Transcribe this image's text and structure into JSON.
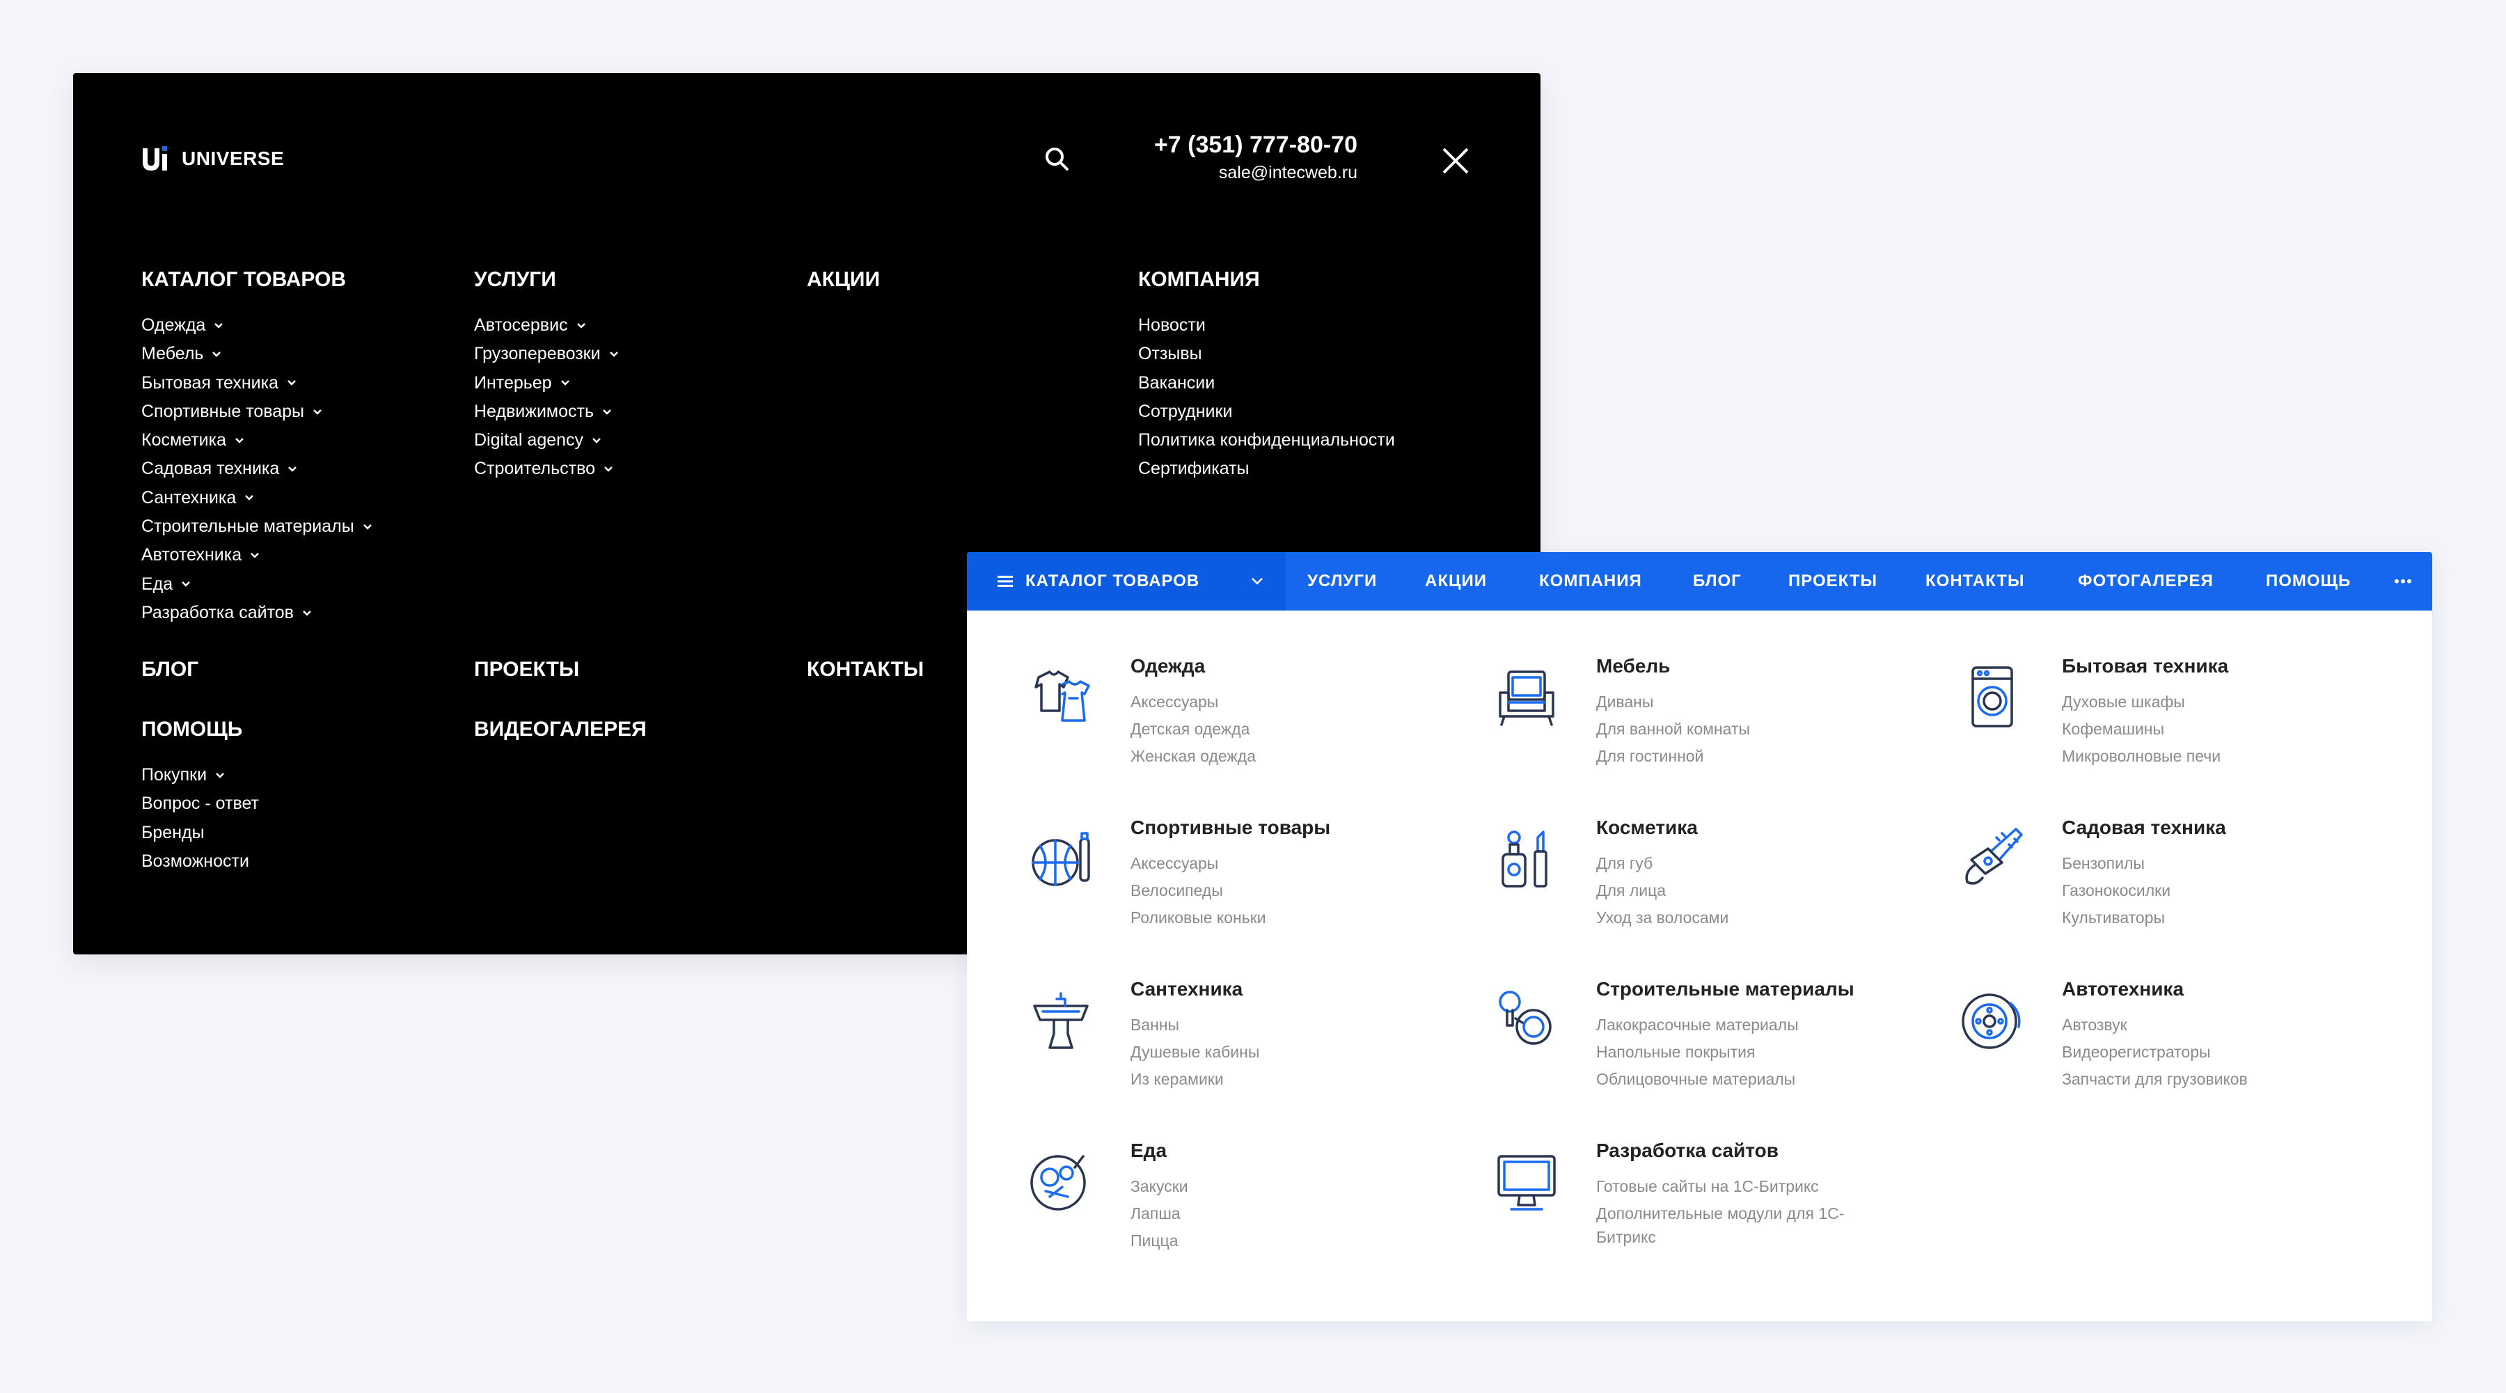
{
  "dark_menu": {
    "logo_text": "UNIVERSE",
    "phone": "+7 (351) 777-80-70",
    "email": "sale@intecweb.ru",
    "columns": [
      {
        "heading": "КАТАЛОГ ТОВАРОВ",
        "items": [
          "Одежда",
          "Мебель",
          "Бытовая техника",
          "Спортивные товары",
          "Косметика",
          "Садовая техника",
          "Сантехника",
          "Строительные материалы",
          "Автотехника",
          "Еда",
          "Разработка сайтов"
        ]
      },
      {
        "heading": "УСЛУГИ",
        "items": [
          "Автосервис",
          "Грузоперевозки",
          "Интерьер",
          "Недвижимость",
          "Digital agency",
          "Строительство"
        ]
      },
      {
        "heading": "АКЦИИ"
      },
      {
        "heading": "КОМПАНИЯ",
        "items": [
          "Новости",
          "Отзывы",
          "Вакансии",
          "Сотрудники",
          "Политика конфиденциальности",
          "Сертификаты"
        ]
      },
      {
        "heading": "БЛОГ"
      },
      {
        "heading": "ПРОЕКТЫ"
      },
      {
        "heading": "КОНТАКТЫ"
      },
      {
        "heading": "ПОМОЩЬ",
        "items": [
          "Покупки",
          "Вопрос - ответ",
          "Бренды",
          "Возможности"
        ]
      },
      {
        "heading": "ВИДЕОГАЛЕРЕЯ"
      }
    ]
  },
  "catalog_panel": {
    "nav": {
      "catalog_label": "КАТАЛОГ ТОВАРОВ",
      "items": [
        "УСЛУГИ",
        "АКЦИИ",
        "КОМПАНИЯ",
        "БЛОГ",
        "ПРОЕКТЫ",
        "КОНТАКТЫ",
        "ФОТОГАЛЕРЕЯ",
        "ПОМОЩЬ"
      ]
    },
    "categories": [
      {
        "title": "Одежда",
        "icon": "clothing-icon",
        "subs": [
          "Аксессуары",
          "Детская одежда",
          "Женская одежда"
        ]
      },
      {
        "title": "Мебель",
        "icon": "armchair-icon",
        "subs": [
          "Диваны",
          "Для ванной комнаты",
          "Для гостинной"
        ]
      },
      {
        "title": "Бытовая техника",
        "icon": "washing-machine-icon",
        "subs": [
          "Духовые шкафы",
          "Кофемашины",
          "Микроволновые печи"
        ]
      },
      {
        "title": "Спортивные товары",
        "icon": "basketball-icon",
        "subs": [
          "Аксессуары",
          "Велосипеды",
          "Роликовые коньки"
        ]
      },
      {
        "title": "Косметика",
        "icon": "cosmetics-icon",
        "subs": [
          "Для губ",
          "Для лица",
          "Уход за волосами"
        ]
      },
      {
        "title": "Садовая техника",
        "icon": "chainsaw-icon",
        "subs": [
          "Бензопилы",
          "Газонокосилки",
          "Культиваторы"
        ]
      },
      {
        "title": "Сантехника",
        "icon": "sink-icon",
        "subs": [
          "Ванны",
          "Душевые кабины",
          "Из керамики"
        ]
      },
      {
        "title": "Строительные материалы",
        "icon": "tools-icon",
        "subs": [
          "Лакокрасочные материалы",
          "Напольные покрытия",
          "Облицовочные материалы"
        ]
      },
      {
        "title": "Автотехника",
        "icon": "brake-disc-icon",
        "subs": [
          "Автозвук",
          "Видеорегистраторы",
          "Запчасти для грузовиков"
        ]
      },
      {
        "title": "Еда",
        "icon": "food-plate-icon",
        "subs": [
          "Закуски",
          "Лапша",
          "Пицца"
        ]
      },
      {
        "title": "Разработка сайтов",
        "icon": "monitor-icon",
        "subs": [
          "Готовые сайты на 1С-Битрикс",
          "Дополнительные модули для 1С-Битрикс"
        ]
      }
    ]
  },
  "colors": {
    "page_bg": "#f3f5fa",
    "dark_bg": "#000000",
    "accent_blue": "#1667ee",
    "accent_blue_dark": "#0b5ce3",
    "icon_blue": "#1a6bf0",
    "icon_dark": "#2a3550",
    "sub_text": "#8a8a8a"
  }
}
